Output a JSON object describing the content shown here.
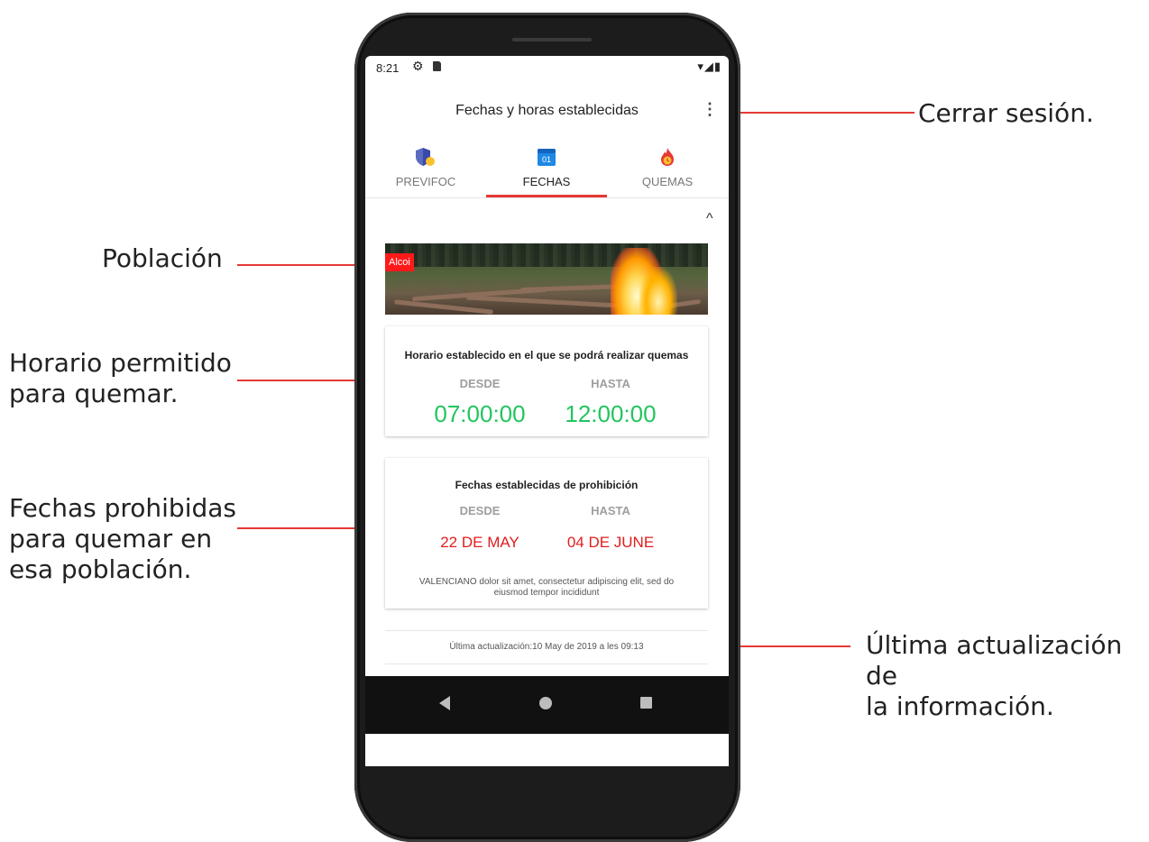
{
  "callouts": {
    "cerrar": "Cerrar sesión.",
    "poblacion": "Población",
    "horario_line1": "Horario permitido",
    "horario_line2": "para quemar.",
    "fechas_line1": "Fechas prohibidas",
    "fechas_line2": "para quemar en",
    "fechas_line3": "esa población.",
    "actualizacion_line1": "Última actualización de",
    "actualizacion_line2": "la información."
  },
  "colors": {
    "accent": "#e53935",
    "allowed_time": "#22c55e",
    "prohibited_date": "#e11d1d",
    "town_badge": "#ff1a1a"
  },
  "status_bar": {
    "time": "8:21",
    "right_icons": "▾◢▮"
  },
  "app_bar": {
    "title": "Fechas y horas establecidas",
    "menu_icon": "⋮"
  },
  "tabs": [
    {
      "label": "PREVIFOC",
      "icon": "shield-icon",
      "active": false
    },
    {
      "label": "FECHAS",
      "icon": "calendar-icon",
      "icon_text": "01",
      "active": true
    },
    {
      "label": "QUEMAS",
      "icon": "fire-icon",
      "active": false
    }
  ],
  "collapse_icon": "^",
  "town": {
    "name": "Alcoi"
  },
  "schedule_card": {
    "title": "Horario establecido en el que se podrá realizar quemas",
    "from_label": "DESDE",
    "to_label": "HASTA",
    "from_value": "07:00:00",
    "to_value": "12:00:00"
  },
  "prohibition_card": {
    "title": "Fechas establecidas de prohibición",
    "from_label": "DESDE",
    "to_label": "HASTA",
    "from_value": "22 DE MAY",
    "to_value": "04 DE JUNE",
    "description": "VALENCIANO dolor sit amet, consectetur adipiscing elit, sed do eiusmod tempor incididunt"
  },
  "last_update": "Última actualización:10 May de 2019 a les 09:13"
}
